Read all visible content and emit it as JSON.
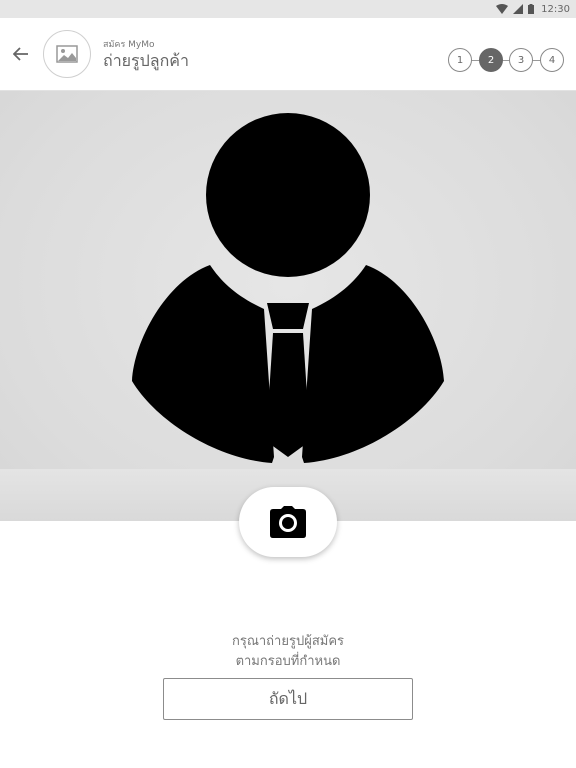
{
  "status_bar": {
    "time": "12:30",
    "icons": [
      "wifi-icon",
      "signal-icon",
      "battery-icon"
    ]
  },
  "header": {
    "back_icon": "arrow-left-icon",
    "avatar_icon": "image-placeholder-icon",
    "subtitle": "สมัคร MyMo",
    "title": "ถ่ายรูปลูกค้า",
    "steps": [
      {
        "label": "1",
        "active": false
      },
      {
        "label": "2",
        "active": true
      },
      {
        "label": "3",
        "active": false
      },
      {
        "label": "4",
        "active": false
      }
    ]
  },
  "photo": {
    "placeholder_icon": "person-with-tie-silhouette",
    "camera_icon": "camera-icon"
  },
  "instructions": {
    "line1": "กรุณาถ่ายรูปผู้สมัคร",
    "line2": "ตามกรอบที่กำหนด"
  },
  "next_button": {
    "label": "ถัดไป"
  },
  "colors": {
    "status_bar_bg": "#e6e6e6",
    "photo_bg": "#dcdcdc",
    "active_step": "#666666",
    "silhouette": "#000000"
  }
}
